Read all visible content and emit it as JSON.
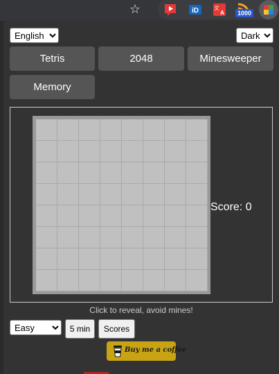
{
  "browser": {
    "extensions": [
      {
        "name": "youtube-red-icon"
      },
      {
        "name": "id-icon"
      },
      {
        "name": "translate-icon"
      },
      {
        "name": "rss-icon",
        "badge": "1000"
      },
      {
        "name": "game-ext-icon"
      }
    ]
  },
  "popup": {
    "language": {
      "selected": "English"
    },
    "theme": {
      "selected": "Dark"
    },
    "games": [
      "Tetris",
      "2048",
      "Minesweeper",
      "Memory"
    ],
    "score_label": "Score: 0",
    "hint": "Click to reveal, avoid mines!",
    "difficulty": {
      "selected": "Easy"
    },
    "time_button": "5 min",
    "scores_button": "Scores",
    "coffee_button": "Buy me a coffee"
  },
  "colors": {
    "panel_bg": "#333333",
    "game_button_bg": "#555555",
    "cell_unrevealed": "#c0c0c0",
    "coffee_bg": "#c8a414"
  }
}
